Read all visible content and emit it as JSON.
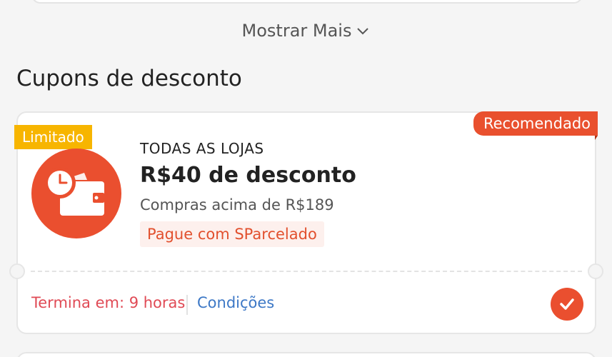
{
  "show_more": {
    "label": "Mostrar Mais",
    "icon": "chevron-down-icon"
  },
  "section": {
    "title": "Cupons de desconto"
  },
  "coupon": {
    "badge_limited": "Limitado",
    "badge_recommended": "Recomendado",
    "icon": "clock-wallet-icon",
    "store": "TODAS AS LOJAS",
    "discount": "R$40 de desconto",
    "min_purchase": "Compras acima de R$189",
    "payment_tag": "Pague com SParcelado",
    "expires": "Termina em: 9 horas",
    "conditions_link": "Condições",
    "selected": true,
    "colors": {
      "accent": "#ea4f2f",
      "limited": "#f7b500",
      "expiry": "#e04a55",
      "link": "#3d78c6"
    }
  }
}
